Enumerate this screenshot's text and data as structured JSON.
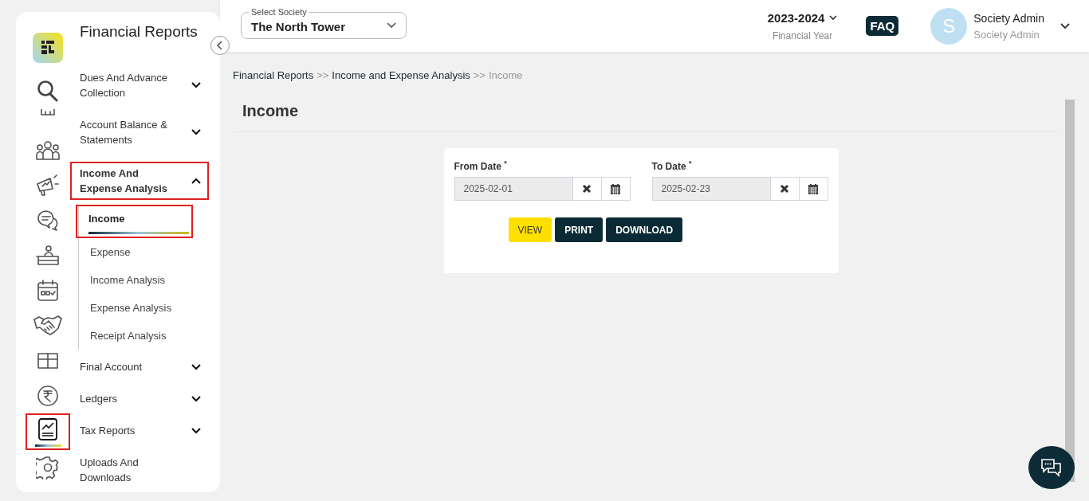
{
  "rail": [
    {
      "selected": false,
      "highlighted": false
    },
    {
      "selected": false,
      "highlighted": false
    },
    {
      "selected": false,
      "highlighted": false
    },
    {
      "selected": false,
      "highlighted": false
    },
    {
      "selected": false,
      "highlighted": false
    },
    {
      "selected": false,
      "highlighted": false
    },
    {
      "selected": false,
      "highlighted": false
    },
    {
      "selected": false,
      "highlighted": false
    },
    {
      "selected": false,
      "highlighted": false
    },
    {
      "selected": false,
      "highlighted": false
    },
    {
      "selected": true,
      "highlighted": true
    },
    {
      "selected": false,
      "highlighted": false
    }
  ],
  "menu": {
    "title": "Financial Reports",
    "items": [
      {
        "label": "Dues And Advance Collection",
        "expanded": false,
        "highlighted": false,
        "kind": "group"
      },
      {
        "label": "Account Balance & Statements",
        "expanded": false,
        "highlighted": false,
        "kind": "group"
      },
      {
        "label": "Income And Expense Analysis",
        "expanded": true,
        "highlighted": true,
        "kind": "group",
        "children": [
          {
            "label": "Income",
            "selected": true,
            "highlighted": true
          },
          {
            "label": "Expense",
            "selected": false,
            "highlighted": false
          },
          {
            "label": "Income Analysis",
            "selected": false,
            "highlighted": false
          },
          {
            "label": "Expense Analysis",
            "selected": false,
            "highlighted": false
          },
          {
            "label": "Receipt Analysis",
            "selected": false,
            "highlighted": false
          }
        ]
      },
      {
        "label": "Final Account",
        "expanded": false,
        "highlighted": false,
        "kind": "group"
      },
      {
        "label": "Ledgers",
        "expanded": false,
        "highlighted": false,
        "kind": "group"
      },
      {
        "label": "Tax Reports",
        "expanded": false,
        "highlighted": false,
        "kind": "group"
      },
      {
        "label": "Uploads And Downloads",
        "expanded": false,
        "highlighted": false,
        "kind": "link"
      }
    ]
  },
  "header": {
    "society_select": {
      "label": "Select Society",
      "value": "The North Tower"
    },
    "year": {
      "value": "2023-2024",
      "label": "Financial Year"
    },
    "faq": "FAQ",
    "user": {
      "initial": "S",
      "name": "Society Admin",
      "role": "Society Admin"
    }
  },
  "breadcrumb": [
    {
      "text": "Financial Reports",
      "current": false
    },
    {
      "text": ">>",
      "kind": "sep"
    },
    {
      "text": "Income and Expense Analysis",
      "current": false
    },
    {
      "text": ">>",
      "kind": "sep"
    },
    {
      "text": "Income",
      "current": true
    }
  ],
  "page_title": "Income",
  "form": {
    "fields": [
      {
        "label": "From Date",
        "required": "*",
        "value": "2025-02-01"
      },
      {
        "label": "To Date",
        "required": "*",
        "value": "2025-02-23"
      }
    ],
    "buttons": [
      {
        "label": "VIEW",
        "kind": "primary"
      },
      {
        "label": "PRINT",
        "kind": "dark"
      },
      {
        "label": "DOWNLOAD",
        "kind": "dark"
      }
    ]
  }
}
